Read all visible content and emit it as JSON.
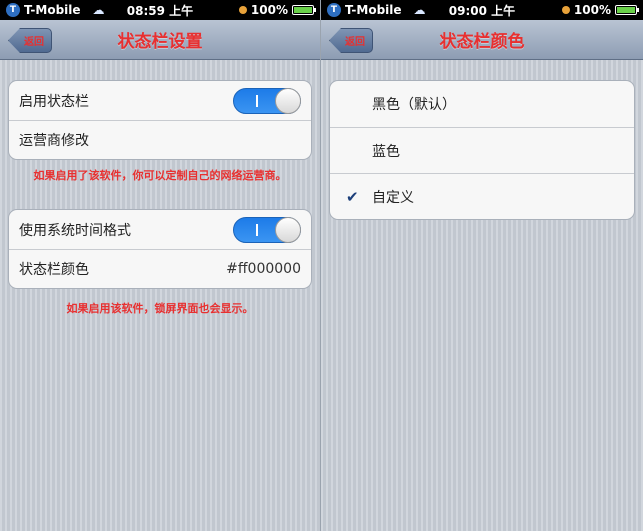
{
  "left": {
    "status_bar": {
      "carrier": "T-Mobile",
      "time": "08:59 上午",
      "battery": "100%"
    },
    "nav": {
      "back_label": "返回",
      "title": "状态栏设置"
    },
    "group1": {
      "rows": [
        {
          "label": "启用状态栏",
          "toggle_on": true
        },
        {
          "label": "运营商修改"
        }
      ],
      "note": "如果启用了该软件，你可以定制自己的网络运营商。"
    },
    "group2": {
      "rows": [
        {
          "label": "使用系统时间格式",
          "toggle_on": true
        },
        {
          "label": "状态栏颜色",
          "value": "#ff000000"
        }
      ],
      "note": "如果启用该软件，锁屏界面也会显示。"
    }
  },
  "right": {
    "status_bar": {
      "carrier": "T-Mobile",
      "time": "09:00 上午",
      "battery": "100%"
    },
    "nav": {
      "back_label": "返回",
      "title": "状态栏颜色"
    },
    "options": [
      {
        "label": "黑色（默认）",
        "checked": false
      },
      {
        "label": "蓝色",
        "checked": false
      },
      {
        "label": "自定义",
        "checked": true
      }
    ],
    "check_glyph": "✔"
  },
  "icons": {
    "carrier_logo": "t-mobile-logo-icon",
    "cloud": "cloud-icon",
    "battery": "battery-icon",
    "toggle": "toggle-switch"
  },
  "colors": {
    "accent_red": "#e83030",
    "toggle_blue": "#1d7be8",
    "nav_top": "#b9c4d3",
    "nav_bottom": "#8d9db3"
  }
}
